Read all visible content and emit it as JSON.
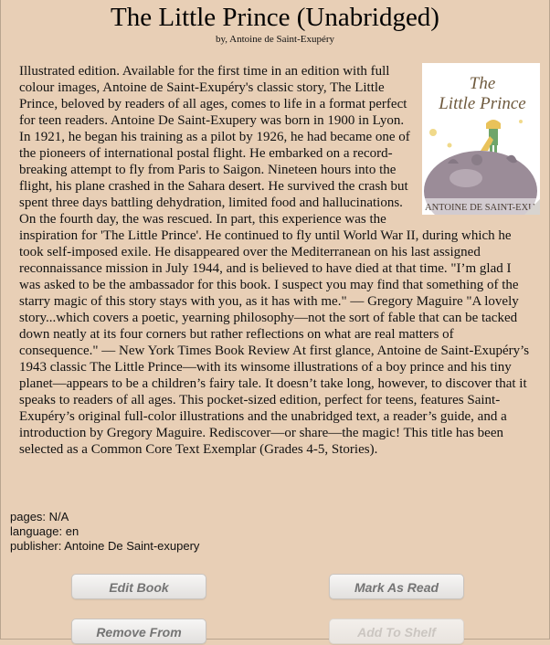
{
  "book": {
    "title": "The Little Prince (Unabridged)",
    "byline": "by, Antoine de Saint-Exupéry",
    "description": "Illustrated edition. Available for the first time in an edition with full colour images, Antoine de Saint-Exupéry's classic story, The Little Prince, beloved by readers of all ages, comes to life in a format perfect for teen readers. Antoine De Saint-Exupery was born in 1900 in Lyon. In 1921, he began his training as a pilot by 1926, he had became one of the pioneers of international postal flight. He embarked on a record-breaking attempt to fly from Paris to Saigon. Nineteen hours into the flight, his plane crashed in the Sahara desert. He survived the crash but spent three days battling dehydration, limited food and hallucinations. On the fourth day, the was rescued. In part, this experience was the inspiration for 'The Little Prince'. He continued to fly until World War II, during which he took self-imposed exile. He disappeared over the Mediterranean on his last assigned reconnaissance mission in July 1944, and is believed to have died at that time. \"I’m glad I was asked to be the ambassador for this book. I suspect you may find that something of the starry magic of this story stays with you, as it has with me.\" — Gregory Maguire \"A lovely story...which covers a poetic, yearning philosophy—not the sort of fable that can be tacked down neatly at its four corners but rather reflections on what are real matters of consequence.\" — New York Times Book Review At first glance, Antoine de Saint-Exupéry’s 1943 classic The Little Prince—with its winsome illustrations of a boy prince and his tiny planet—appears to be a children’s fairy tale. It doesn’t take long, however, to discover that it speaks to readers of all ages. This pocket-sized edition, perfect for teens, features Saint-Exupéry’s original full-color illustrations and the unabridged text, a reader’s guide, and a introduction by Gregory Maguire. Rediscover—or share—the magic! This title has been selected as a Common Core Text Exemplar (Grades 4-5, Stories).",
    "cover": {
      "title_line1": "The",
      "title_line2": "Little Prince",
      "author": "ANTOINE DE SAINT-EXU"
    }
  },
  "meta": {
    "pages": "pages: N/A",
    "language": "language: en",
    "publisher": "publisher: Antoine De Saint-exupery"
  },
  "actions": {
    "edit_book": "Edit Book",
    "mark_as_read": "Mark As Read",
    "remove_from": "Remove From",
    "add_to_shelf": "Add To Shelf"
  },
  "colors": {
    "background": "#e8cfb6",
    "button_text": "#747474",
    "button_disabled_text": "#cbc6c1"
  }
}
